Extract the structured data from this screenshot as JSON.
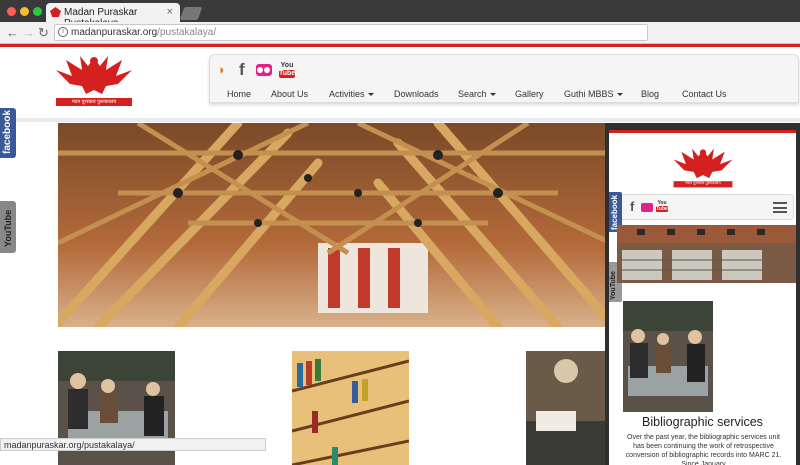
{
  "browser": {
    "tab_title": "Madan Puraskar Pustakalaya",
    "tab_close": "×",
    "url_domain": "madanpuraskar.org",
    "url_path": "/pustakalaya/",
    "back": "←",
    "forward": "→",
    "reload": "↻",
    "status_url": "madanpuraskar.org/pustakalaya/"
  },
  "header": {
    "logo_caption": "मदन पुरस्कार पुस्तकालय",
    "social": {
      "rss": "◗",
      "facebook": "f",
      "youtube_top": "You",
      "youtube_bottom": "Tube"
    }
  },
  "nav": {
    "items": [
      {
        "label": "Home"
      },
      {
        "label": "About Us"
      },
      {
        "label": "Activities"
      },
      {
        "label": "Downloads"
      },
      {
        "label": "Search"
      },
      {
        "label": "Gallery"
      },
      {
        "label": "Guthi MBBS"
      },
      {
        "label": "Blog"
      },
      {
        "label": "Contact Us"
      }
    ]
  },
  "sidebar": {
    "facebook": "facebook",
    "youtube": "YouTube"
  },
  "mobile": {
    "logo_caption": "मदन पुरस्कार पुस्तकालय",
    "facebook": "facebook",
    "youtube": "YouTube",
    "section_title": "Bibliographic services",
    "section_text": "Over the past year, the bibliographic services unit has been continuing the work of retrospective conversion of bibliographic records into MARC 21. Since January"
  },
  "colors": {
    "brand_red": "#d52020",
    "facebook_blue": "#3b5998",
    "flickr_pink": "#e3218c",
    "rss_orange": "#e8711a"
  }
}
